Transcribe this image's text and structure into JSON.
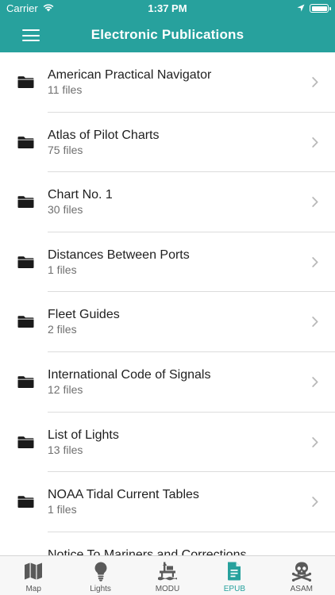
{
  "status_bar": {
    "carrier": "Carrier",
    "time": "1:37 PM"
  },
  "nav": {
    "title": "Electronic Publications"
  },
  "colors": {
    "accent": "#27a19d",
    "icon_dark": "#1a1a1a",
    "tab_inactive": "#5a5a5a"
  },
  "publications": [
    {
      "title": "American Practical Navigator",
      "subtitle": "11 files"
    },
    {
      "title": "Atlas of Pilot Charts",
      "subtitle": "75 files"
    },
    {
      "title": "Chart No. 1",
      "subtitle": "30 files"
    },
    {
      "title": "Distances Between Ports",
      "subtitle": "1 files"
    },
    {
      "title": "Fleet Guides",
      "subtitle": "2 files"
    },
    {
      "title": "International Code of Signals",
      "subtitle": "12 files"
    },
    {
      "title": "List of Lights",
      "subtitle": "13 files"
    },
    {
      "title": "NOAA Tidal Current Tables",
      "subtitle": "1 files"
    },
    {
      "title": "Notice To Mariners and Corrections",
      "subtitle": ""
    }
  ],
  "tabs": [
    {
      "label": "Map",
      "icon": "map-icon"
    },
    {
      "label": "Lights",
      "icon": "lightbulb-icon"
    },
    {
      "label": "MODU",
      "icon": "oil-rig-icon"
    },
    {
      "label": "EPUB",
      "icon": "document-icon",
      "active": true
    },
    {
      "label": "ASAM",
      "icon": "skull-crossbones-icon"
    }
  ]
}
